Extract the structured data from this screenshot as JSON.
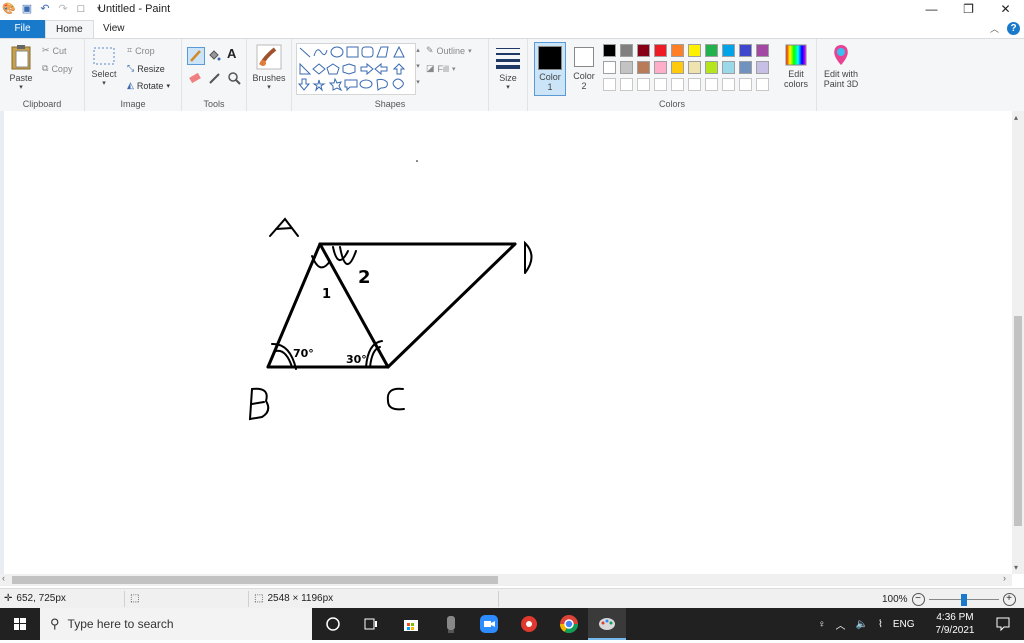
{
  "window": {
    "title": "Untitled - Paint"
  },
  "tabs": [
    {
      "label": "File"
    },
    {
      "label": "Home"
    },
    {
      "label": "View"
    }
  ],
  "clipboard": {
    "paste": "Paste",
    "cut": "Cut",
    "copy": "Copy",
    "group": "Clipboard"
  },
  "image": {
    "select": "Select",
    "crop": "Crop",
    "resize": "Resize",
    "rotate": "Rotate",
    "group": "Image"
  },
  "tools": {
    "group": "Tools"
  },
  "brushes": {
    "label": "Brushes"
  },
  "shapes": {
    "outline": "Outline",
    "fill": "Fill",
    "group": "Shapes"
  },
  "size": {
    "label": "Size"
  },
  "colors": {
    "color1": "Color",
    "color1_num": "1",
    "color2": "Color",
    "color2_num": "2",
    "edit": "Edit",
    "edit2": "colors",
    "paint3d": "Edit with",
    "paint3d2": "Paint 3D",
    "group": "Colors",
    "palette_row1": [
      "#000000",
      "#7f7f7f",
      "#880015",
      "#ed1c24",
      "#ff7f27",
      "#fff200",
      "#22b14c",
      "#00a2e8",
      "#3f48cc",
      "#a349a4"
    ],
    "palette_row2": [
      "#ffffff",
      "#c3c3c3",
      "#b97a57",
      "#ffaec9",
      "#ffc90e",
      "#efe4b0",
      "#b5e61d",
      "#99d9ea",
      "#7092be",
      "#c8bfe7"
    ]
  },
  "drawing": {
    "labels": [
      {
        "text": "A"
      },
      {
        "text": "B"
      },
      {
        "text": "C"
      },
      {
        "text": "D"
      },
      {
        "text": "1"
      },
      {
        "text": "2"
      },
      {
        "text": "70°"
      },
      {
        "text": "30°"
      }
    ]
  },
  "status": {
    "cursor": "652, 725px",
    "dimensions": "2548 × 1196px",
    "zoom": "100%"
  },
  "taskbar": {
    "search_placeholder": "Type here to search",
    "lang": "ENG",
    "time": "4:36 PM",
    "date": "7/9/2021"
  }
}
